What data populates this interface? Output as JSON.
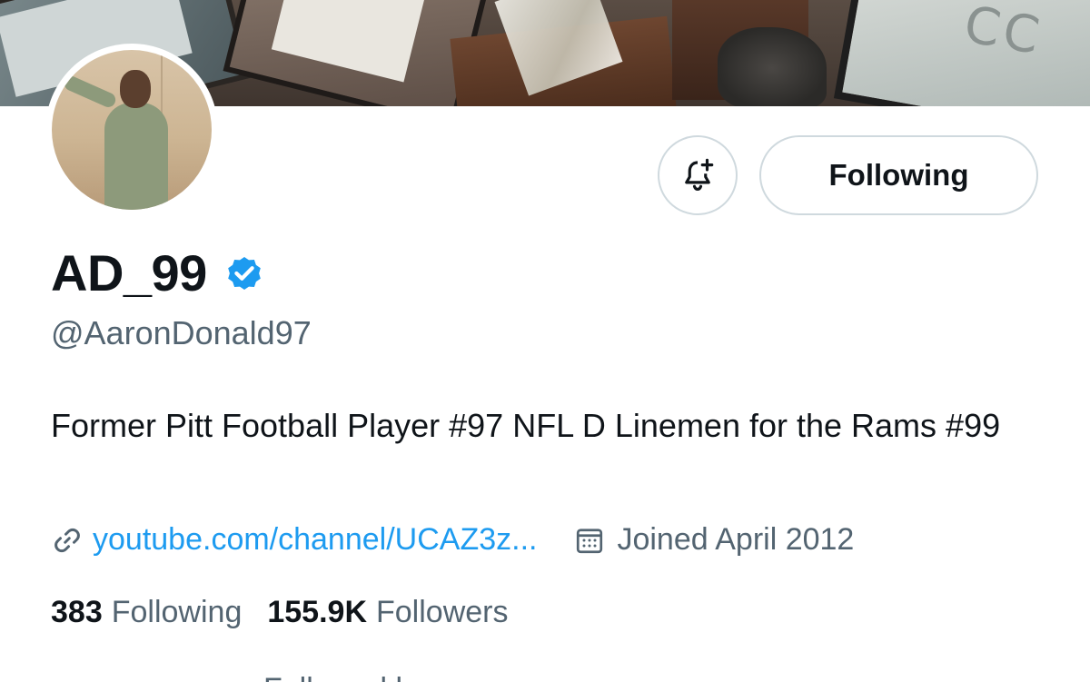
{
  "profile": {
    "display_name": "AD_99",
    "handle": "@AaronDonald97",
    "bio": "Former Pitt Football Player #97 NFL D Linemen for the Rams #99",
    "website": "youtube.com/channel/UCAZ3z...",
    "joined": "Joined April 2012",
    "verified": true
  },
  "actions": {
    "following_label": "Following",
    "notify_icon": "bell-plus-icon"
  },
  "stats": {
    "following_count": "383",
    "following_label": "Following",
    "followers_count": "155.9K",
    "followers_label": "Followers"
  },
  "followed_by": "Followed by ...",
  "colors": {
    "link": "#1d9bf0",
    "secondary_text": "#536471",
    "primary_text": "#0f1419",
    "border": "#cfd9de",
    "verified": "#1d9bf0"
  }
}
